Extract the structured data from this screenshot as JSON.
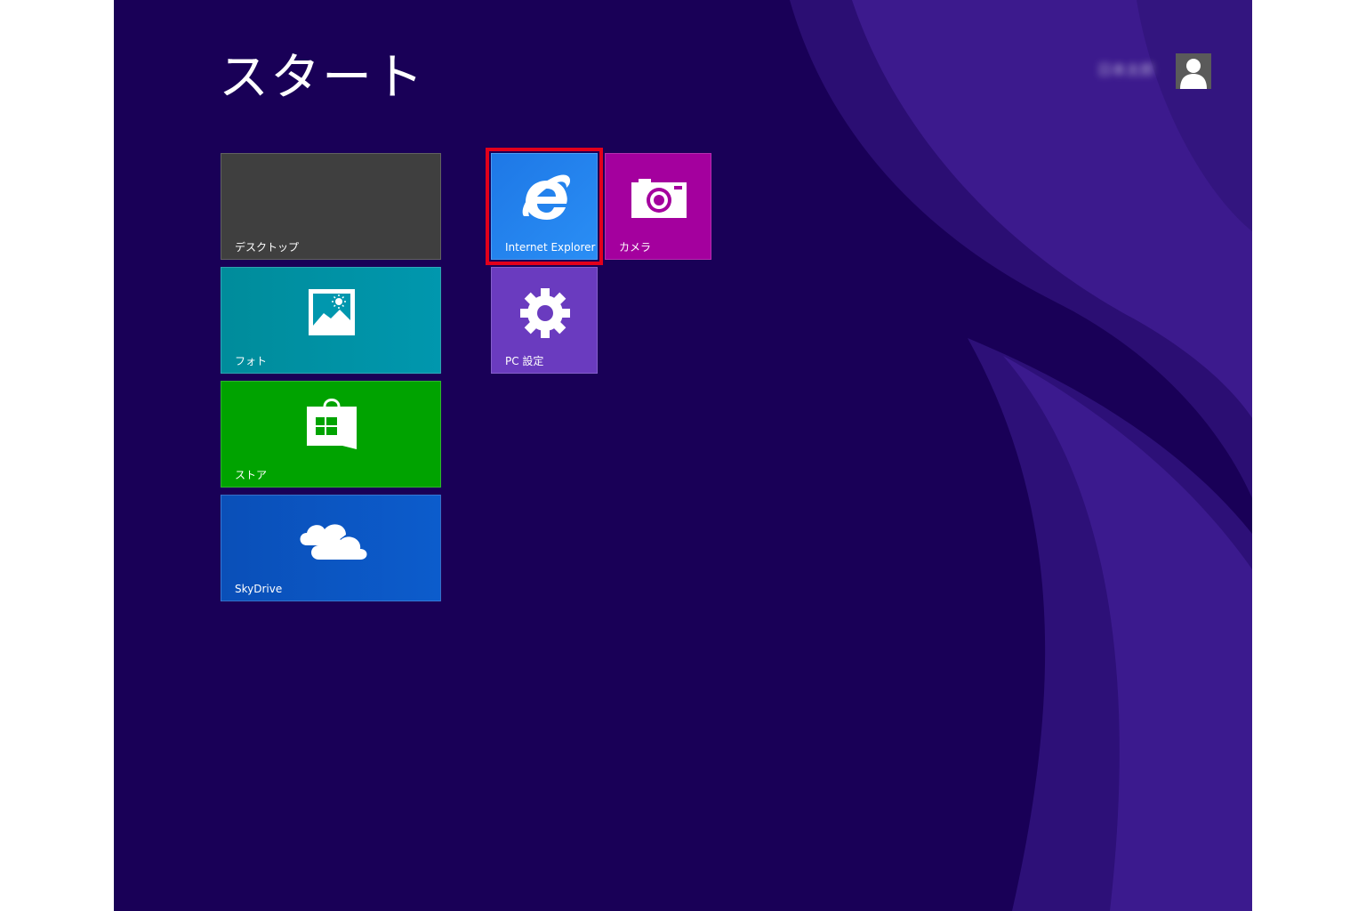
{
  "start": {
    "title": "スタート"
  },
  "user": {
    "name": "日本太郎",
    "avatar_icon": "user-silhouette-icon"
  },
  "tiles": {
    "desktop": {
      "label": "デスクトップ",
      "color": "#3f3f3f"
    },
    "photos": {
      "label": "フォト",
      "icon": "photos-icon",
      "color": "#0097ae"
    },
    "store": {
      "label": "ストア",
      "icon": "store-bag-icon",
      "color": "#00a300"
    },
    "skydrive": {
      "label": "SkyDrive",
      "icon": "cloud-icon",
      "color": "#0c5ccc"
    },
    "ie": {
      "label": "Internet Explorer",
      "icon": "internet-explorer-icon",
      "color": "#2a8ef5",
      "highlighted": true
    },
    "camera": {
      "label": "カメラ",
      "icon": "camera-icon",
      "color": "#a4009e"
    },
    "pcsettings": {
      "label": "PC 設定",
      "icon": "gear-icon",
      "color": "#6a3bbf"
    }
  },
  "colors": {
    "background": "#190057",
    "highlight": "#e3001b"
  }
}
